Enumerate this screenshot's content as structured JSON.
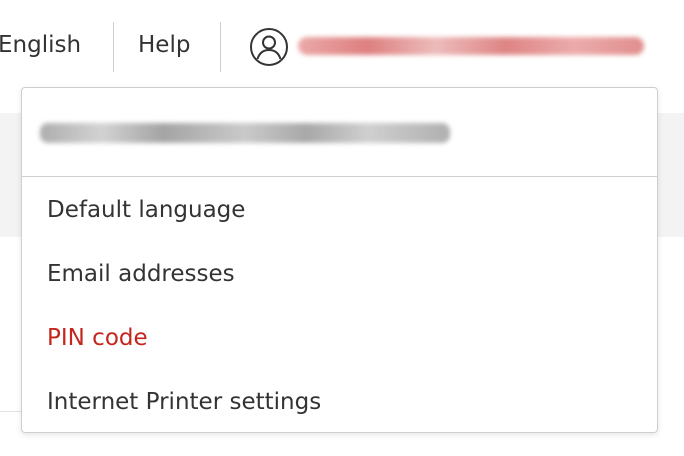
{
  "nav": {
    "language_label": "English",
    "help_label": "Help",
    "user_icon": "user-circle-icon"
  },
  "dropdown": {
    "items": [
      {
        "label": "Default language"
      },
      {
        "label": "Email addresses"
      },
      {
        "label": "PIN code"
      },
      {
        "label": "Internet Printer settings"
      }
    ]
  },
  "colors": {
    "text": "#333333",
    "active": "#c4261d",
    "border": "#cfcfcf"
  }
}
